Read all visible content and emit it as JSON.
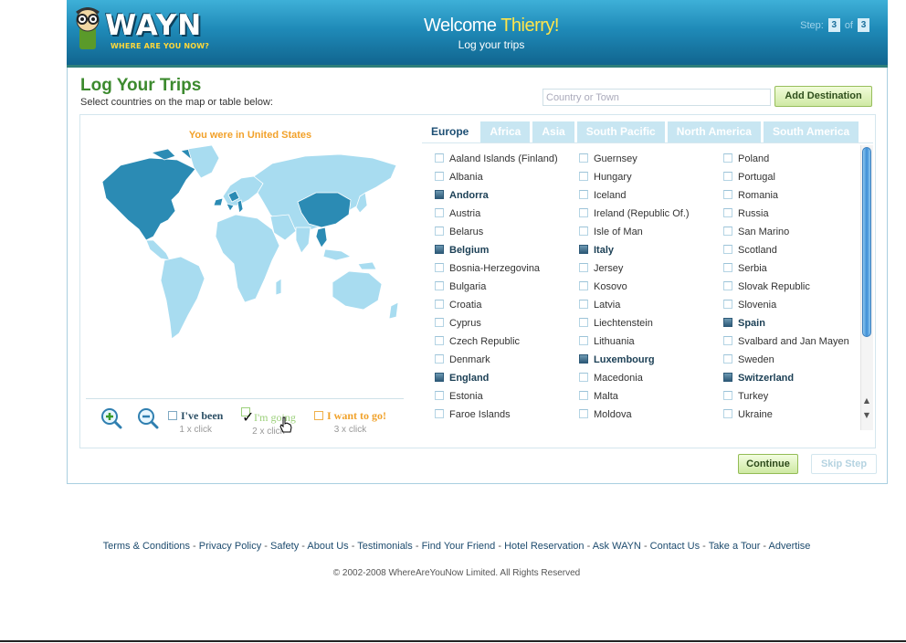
{
  "header": {
    "logo_text": "WAYN",
    "logo_tagline": "WHERE ARE YOU NOW?",
    "welcome_prefix": "Welcome",
    "user_name": "Thierry!",
    "subtitle": "Log your trips",
    "step_label": "Step:",
    "step_current": "3",
    "step_of": "of",
    "step_total": "3"
  },
  "page": {
    "title": "Log Your Trips",
    "instructions": "Select countries on the map or table below:",
    "search_placeholder": "Country or Town",
    "add_button": "Add Destination"
  },
  "map": {
    "caption": "You were in United States",
    "colors": {
      "land": "#a8dcf0",
      "visited": "#2b8bb4",
      "ocean": "#ffffff"
    },
    "legend": {
      "been": {
        "label": "I've been",
        "hint": "1 x click",
        "color": "#2b6e96"
      },
      "going": {
        "label": "I'm going",
        "hint": "2 x click",
        "color": "#8fcf5e"
      },
      "want": {
        "label": "I want to go!",
        "hint": "3 x click",
        "color": "#f0a22b"
      }
    }
  },
  "tabs": [
    "Europe",
    "Africa",
    "Asia",
    "South Pacific",
    "North America",
    "South America"
  ],
  "active_tab": "Europe",
  "countries": {
    "col1": [
      {
        "name": "Aaland Islands (Finland)",
        "selected": false
      },
      {
        "name": "Albania",
        "selected": false
      },
      {
        "name": "Andorra",
        "selected": true
      },
      {
        "name": "Austria",
        "selected": false
      },
      {
        "name": "Belarus",
        "selected": false
      },
      {
        "name": "Belgium",
        "selected": true
      },
      {
        "name": "Bosnia-Herzegovina",
        "selected": false
      },
      {
        "name": "Bulgaria",
        "selected": false
      },
      {
        "name": "Croatia",
        "selected": false
      },
      {
        "name": "Cyprus",
        "selected": false
      },
      {
        "name": "Czech Republic",
        "selected": false
      },
      {
        "name": "Denmark",
        "selected": false
      },
      {
        "name": "England",
        "selected": true
      },
      {
        "name": "Estonia",
        "selected": false
      },
      {
        "name": "Faroe Islands",
        "selected": false
      }
    ],
    "col2": [
      {
        "name": "Guernsey",
        "selected": false
      },
      {
        "name": "Hungary",
        "selected": false
      },
      {
        "name": "Iceland",
        "selected": false
      },
      {
        "name": "Ireland (Republic Of.)",
        "selected": false
      },
      {
        "name": "Isle of Man",
        "selected": false
      },
      {
        "name": "Italy",
        "selected": true
      },
      {
        "name": "Jersey",
        "selected": false
      },
      {
        "name": "Kosovo",
        "selected": false
      },
      {
        "name": "Latvia",
        "selected": false
      },
      {
        "name": "Liechtenstein",
        "selected": false
      },
      {
        "name": "Lithuania",
        "selected": false
      },
      {
        "name": "Luxembourg",
        "selected": true
      },
      {
        "name": "Macedonia",
        "selected": false
      },
      {
        "name": "Malta",
        "selected": false
      },
      {
        "name": "Moldova",
        "selected": false
      }
    ],
    "col3": [
      {
        "name": "Poland",
        "selected": false
      },
      {
        "name": "Portugal",
        "selected": false
      },
      {
        "name": "Romania",
        "selected": false
      },
      {
        "name": "Russia",
        "selected": false
      },
      {
        "name": "San Marino",
        "selected": false
      },
      {
        "name": "Scotland",
        "selected": false
      },
      {
        "name": "Serbia",
        "selected": false
      },
      {
        "name": "Slovak Republic",
        "selected": false
      },
      {
        "name": "Slovenia",
        "selected": false
      },
      {
        "name": "Spain",
        "selected": true
      },
      {
        "name": "Svalbard and Jan Mayen",
        "selected": false
      },
      {
        "name": "Sweden",
        "selected": false
      },
      {
        "name": "Switzerland",
        "selected": true
      },
      {
        "name": "Turkey",
        "selected": false
      },
      {
        "name": "Ukraine",
        "selected": false
      }
    ]
  },
  "buttons": {
    "continue": "Continue",
    "skip": "Skip Step"
  },
  "footer": {
    "links": [
      "Terms & Conditions",
      "Privacy Policy",
      "Safety",
      "About Us",
      "Testimonials",
      "Find Your Friend",
      "Hotel Reservation",
      "Ask WAYN",
      "Contact Us",
      "Take a Tour",
      "Advertise"
    ],
    "separator": "-",
    "copyright": "© 2002-2008 WhereAreYouNow Limited. All Rights Reserved"
  }
}
